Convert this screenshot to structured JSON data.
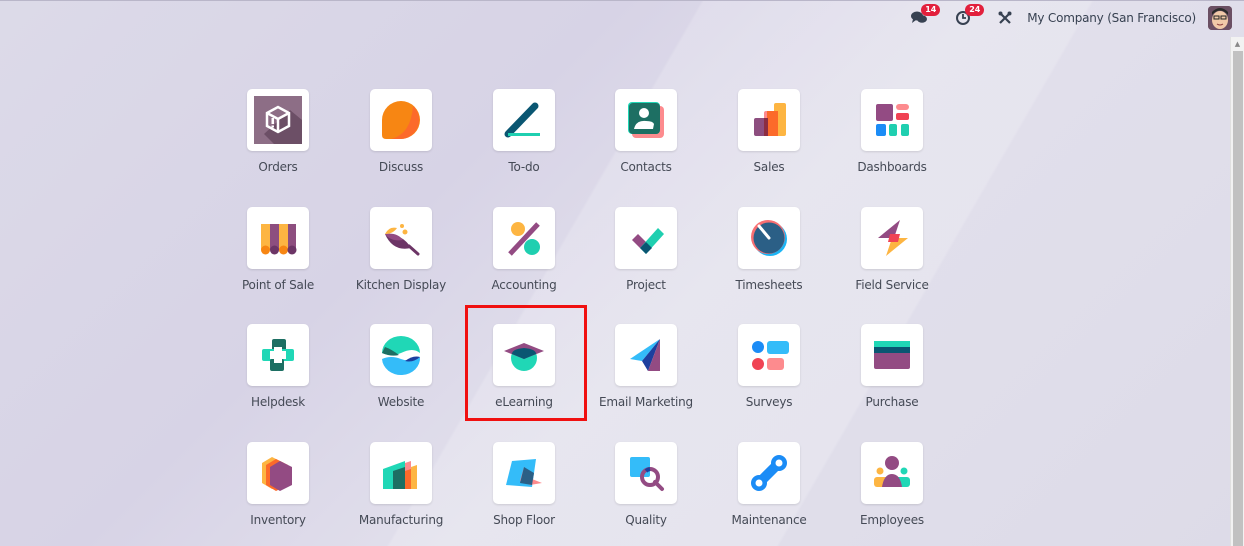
{
  "topbar": {
    "messages": {
      "icon": "chat-icon",
      "count": "14"
    },
    "activities": {
      "icon": "clock-icon",
      "count": "24"
    },
    "tools": {
      "icon": "tools-icon"
    },
    "company": "My Company (San Francisco)",
    "avatar": {
      "icon": "user-avatar"
    }
  },
  "apps": [
    {
      "label": "Orders",
      "icon": "orders-icon"
    },
    {
      "label": "Discuss",
      "icon": "discuss-icon"
    },
    {
      "label": "To-do",
      "icon": "todo-icon"
    },
    {
      "label": "Contacts",
      "icon": "contacts-icon"
    },
    {
      "label": "Sales",
      "icon": "sales-icon"
    },
    {
      "label": "Dashboards",
      "icon": "dashboards-icon"
    },
    {
      "label": "Point of Sale",
      "icon": "point-of-sale-icon"
    },
    {
      "label": "Kitchen Display",
      "icon": "kitchen-display-icon"
    },
    {
      "label": "Accounting",
      "icon": "accounting-icon"
    },
    {
      "label": "Project",
      "icon": "project-icon"
    },
    {
      "label": "Timesheets",
      "icon": "timesheets-icon"
    },
    {
      "label": "Field Service",
      "icon": "field-service-icon"
    },
    {
      "label": "Helpdesk",
      "icon": "helpdesk-icon"
    },
    {
      "label": "Website",
      "icon": "website-icon"
    },
    {
      "label": "eLearning",
      "icon": "elearning-icon"
    },
    {
      "label": "Email Marketing",
      "icon": "email-marketing-icon"
    },
    {
      "label": "Surveys",
      "icon": "surveys-icon"
    },
    {
      "label": "Purchase",
      "icon": "purchase-icon"
    },
    {
      "label": "Inventory",
      "icon": "inventory-icon"
    },
    {
      "label": "Manufacturing",
      "icon": "manufacturing-icon"
    },
    {
      "label": "Shop Floor",
      "icon": "shop-floor-icon"
    },
    {
      "label": "Quality",
      "icon": "quality-icon"
    },
    {
      "label": "Maintenance",
      "icon": "maintenance-icon"
    },
    {
      "label": "Employees",
      "icon": "employees-icon"
    }
  ],
  "highlighted_app": "eLearning"
}
